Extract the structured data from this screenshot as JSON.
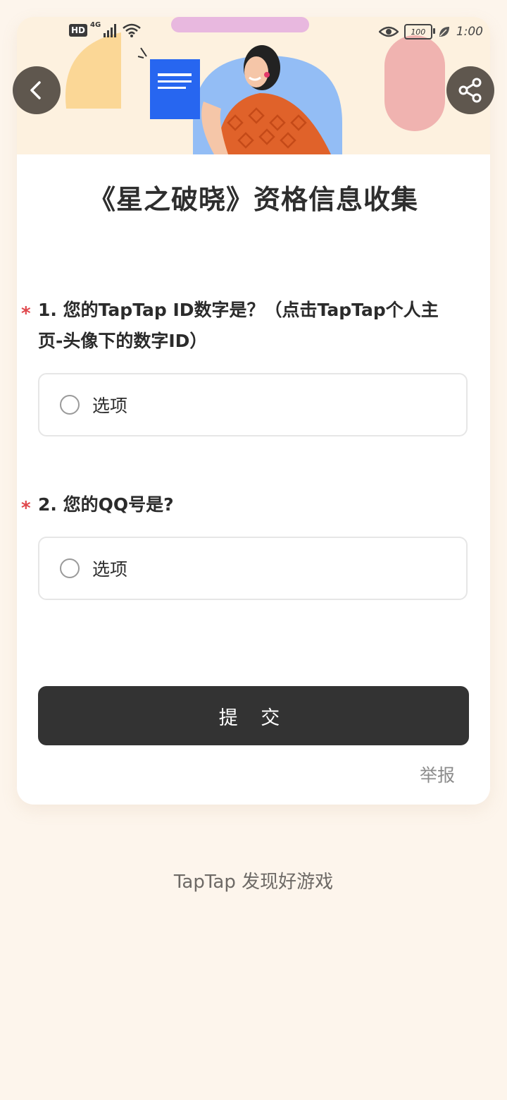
{
  "status_bar": {
    "hd_label": "HD",
    "network_label": "4G",
    "battery_level": "100",
    "time": "1:00"
  },
  "colors": {
    "background": "#fdf5ec",
    "card": "#ffffff",
    "accent_dark": "#333333",
    "required_star": "#e0474c"
  },
  "header": {
    "back_icon": "chevron-left-icon",
    "share_icon": "share-icon"
  },
  "form": {
    "title": "《星之破晓》资格信息收集",
    "questions": [
      {
        "required_mark": "*",
        "text": "1. 您的TapTap ID数字是？（点击TapTap个人主页-头像下的数字ID）",
        "option_label": "选项"
      },
      {
        "required_mark": "*",
        "text": "2. 您的QQ号是?",
        "option_label": "选项"
      }
    ],
    "submit_label": "提 交",
    "report_label": "举报"
  },
  "footer": {
    "text": "TapTap 发现好游戏"
  }
}
